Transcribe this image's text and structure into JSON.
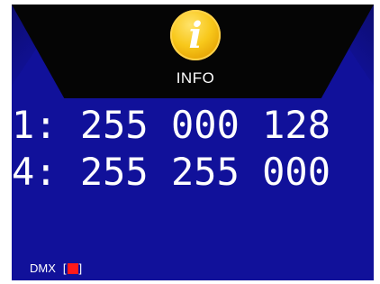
{
  "header": {
    "icon": "info-icon",
    "icon_glyph": "i",
    "label": "INFO"
  },
  "channels": [
    {
      "text": "1: 255 000 128"
    },
    {
      "text": "4: 255 255 000"
    }
  ],
  "status": {
    "label": "DMX",
    "bracket_open": "[",
    "bracket_close": "]",
    "indicator_color": "#ff1a1a"
  },
  "colors": {
    "background": "#11119a",
    "header": "#050505",
    "text": "#ffffff",
    "accent": "#f8c81b"
  }
}
